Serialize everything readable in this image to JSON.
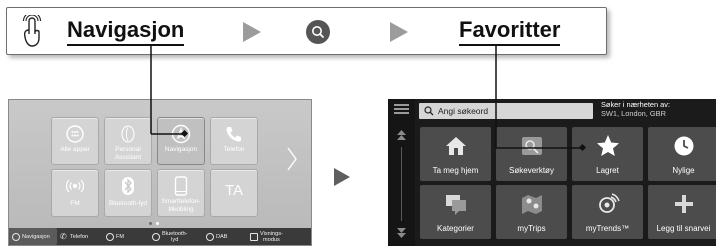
{
  "instruction": {
    "step1": "Navigasjon",
    "step3": "Favoritter",
    "step_icon_1": "touch-finger-icon",
    "step_icon_2": "search-icon"
  },
  "home_menu": {
    "tiles": [
      {
        "label": "Alle apper",
        "icon": "grid-icon"
      },
      {
        "label": "Personal\nAssistant",
        "icon": "assistant-icon"
      },
      {
        "label": "Navigasjon",
        "icon": "compass-icon",
        "selected": true
      },
      {
        "label": "Telefon",
        "icon": "phone-icon"
      },
      {
        "label": "FM",
        "icon": "radio-icon"
      },
      {
        "label": "Bluetooth-lyd",
        "icon": "bluetooth-icon"
      },
      {
        "label": "Smarttelefon-\ntilkobling",
        "icon": "smartphone-icon"
      },
      {
        "label": "TA",
        "icon": "ta-icon"
      }
    ],
    "nav_strip": [
      {
        "label": "Navigasjon",
        "active": true
      },
      {
        "label": "Telefon"
      },
      {
        "label": "FM"
      },
      {
        "label": "Bluetooth-\nlyd"
      },
      {
        "label": "DAB"
      },
      {
        "label": "Visnings-\nmodus"
      }
    ]
  },
  "search_menu": {
    "search_placeholder": "Angi søkeord",
    "near_label": "Søker i nærheten av:",
    "near_value": "SW1, London, GBR",
    "tiles": [
      {
        "label": "Ta meg hjem",
        "icon": "home-icon"
      },
      {
        "label": "Søkeverktøy",
        "icon": "search-tools-icon"
      },
      {
        "label": "Lagret",
        "icon": "star-icon"
      },
      {
        "label": "Nylige",
        "icon": "clock-icon"
      },
      {
        "label": "Kategorier",
        "icon": "categories-icon"
      },
      {
        "label": "myTrips",
        "icon": "mytrips-icon"
      },
      {
        "label": "myTrends™",
        "icon": "mytrends-icon"
      },
      {
        "label": "Legg til snarvei",
        "icon": "plus-icon"
      }
    ]
  },
  "colors": {
    "home_bg": "#c4c4c4",
    "search_bg": "#1b1b1b",
    "search_tile": "#4c4c4c",
    "arrow_grey": "#9c9c9c"
  }
}
